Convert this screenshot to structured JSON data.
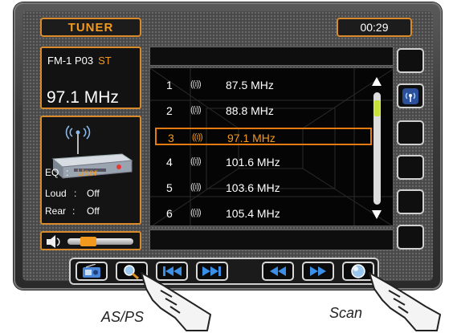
{
  "header": {
    "title": "TUNER",
    "time": "00:29"
  },
  "status": {
    "band_preset": "FM-1  P03",
    "stereo": "ST",
    "frequency": "97.1 MHz"
  },
  "sound": {
    "eq_label": "EQ",
    "eq_sep": ":",
    "eq_value": "User",
    "loud_label": "Loud",
    "loud_sep": ":",
    "loud_value": "Off",
    "rear_label": "Rear",
    "rear_sep": ":",
    "rear_value": "Off"
  },
  "volume": {
    "level": 0.25
  },
  "stations": [
    {
      "num": "1",
      "freq": "87.5 MHz",
      "selected": false
    },
    {
      "num": "2",
      "freq": "88.8 MHz",
      "selected": false
    },
    {
      "num": "3",
      "freq": "97.1 MHz",
      "selected": true
    },
    {
      "num": "4",
      "freq": "101.6 MHz",
      "selected": false
    },
    {
      "num": "5",
      "freq": "103.6 MHz",
      "selected": false
    },
    {
      "num": "6",
      "freq": "105.4 MHz",
      "selected": false
    }
  ],
  "antenna_glyph": "((ı))",
  "bottom_buttons": [
    "radio-icon",
    "search-icon",
    "skip-back-icon",
    "skip-forward-icon",
    "rewind-icon",
    "fast-forward-icon",
    "scan-icon"
  ],
  "captions": {
    "as_ps": "AS/PS",
    "scan": "Scan"
  },
  "colors": {
    "accent": "#f39a1e",
    "select_border": "#e37a12",
    "scroll_thumb": "#c8e23a"
  }
}
